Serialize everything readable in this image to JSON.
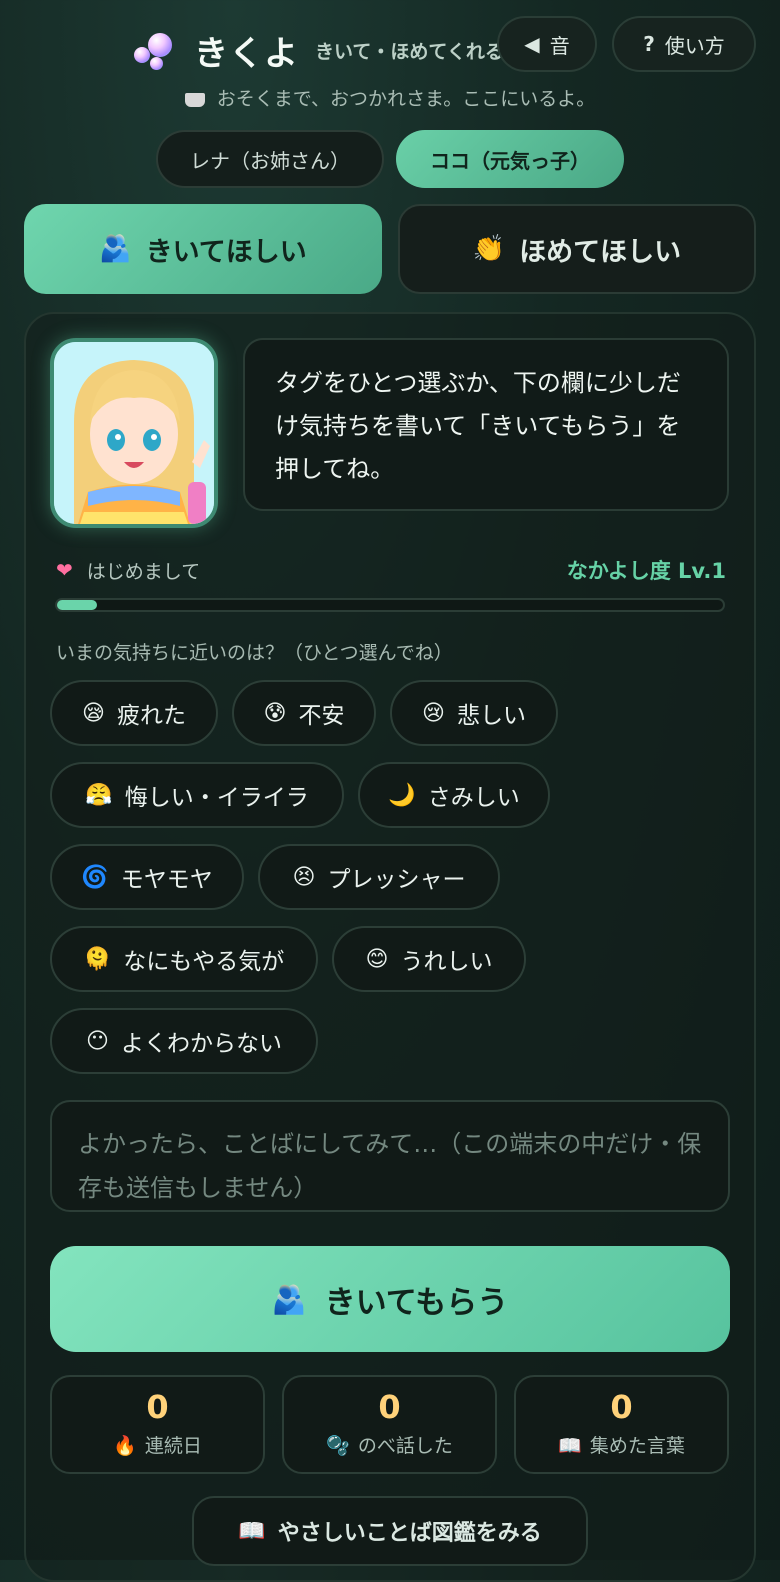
{
  "header": {
    "title": "きくよ",
    "subtitle": "きいて・ほめてくれる部屋",
    "tagline": "おそくまで、おつかれさま。ここにいるよ。",
    "sound_label": "音",
    "help_label": "使い方"
  },
  "characters": [
    {
      "label": "レナ（お姉さん）",
      "selected": false
    },
    {
      "label": "ココ（元気っ子）",
      "selected": true
    }
  ],
  "modes": [
    {
      "label": "きいてほしい",
      "icon": "hug-icon",
      "emoji": "🫂",
      "selected": true
    },
    {
      "label": "ほめてほしい",
      "icon": "clap-icon",
      "emoji": "👏",
      "selected": false
    }
  ],
  "speech": "タグをひとつ選ぶか、下の欄に少しだけ気持ちを書いて「きいてもらう」を押してね。",
  "relationship": {
    "status": "はじめまして",
    "level_label": "なかよし度 Lv.1",
    "progress": 0.06
  },
  "prompt": "いまの気持ちに近いのは？（ひとつ選んでね）",
  "tags": [
    {
      "emoji": "😪",
      "label": "疲れた"
    },
    {
      "emoji": "😰",
      "label": "不安"
    },
    {
      "emoji": "😢",
      "label": "悲しい"
    },
    {
      "emoji": "😤",
      "label": "悔しい・イライラ"
    },
    {
      "emoji": "🌙",
      "label": "さみしい"
    },
    {
      "emoji": "🌀",
      "label": "モヤモヤ"
    },
    {
      "emoji": "😣",
      "label": "プレッシャー"
    },
    {
      "emoji": "🫠",
      "label": "なにもやる気が"
    },
    {
      "emoji": "😊",
      "label": "うれしい"
    },
    {
      "emoji": "😶",
      "label": "よくわからない"
    }
  ],
  "input": {
    "placeholder": "よかったら、ことばにしてみて…（この端末の中だけ・保存も送信もしません）"
  },
  "submit_label": "きいてもらう",
  "submit_emoji": "🫂",
  "stats": [
    {
      "value": "0",
      "emoji": "🔥",
      "label": "連続日"
    },
    {
      "value": "0",
      "emoji": "🫧",
      "label": "のべ話した"
    },
    {
      "value": "0",
      "emoji": "📖",
      "label": "集めた言葉"
    }
  ],
  "dex_label": "やさしいことば図鑑をみる",
  "dex_emoji": "📖"
}
